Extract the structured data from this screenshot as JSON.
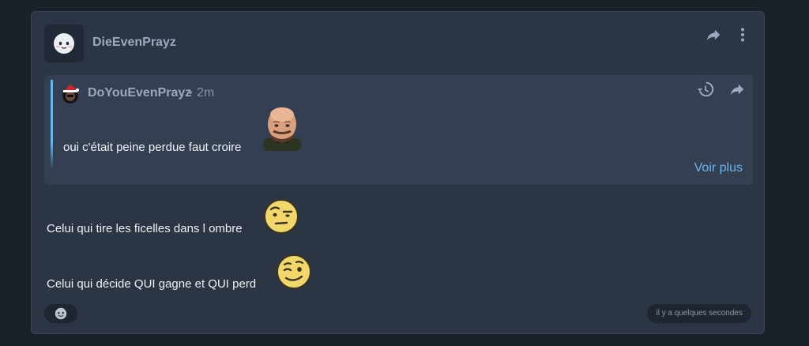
{
  "post": {
    "author": "DieEvenPrayz",
    "avatar_icon": "ghost-face-icon",
    "actions": {
      "share_icon": "share-arrow-icon",
      "menu_icon": "vertical-dots-icon"
    }
  },
  "quote": {
    "author": "DoYouEvenPrayz",
    "separator": "•",
    "time": "2m",
    "text": "oui c'était peine perdue faut croire",
    "emoji_icon": "bald-man-face-icon",
    "history_icon": "history-icon",
    "share_icon": "share-arrow-icon",
    "see_more": "Voir plus",
    "accent": "#67b5ef"
  },
  "messages": [
    {
      "text": "Celui qui tire les ficelles dans l ombre",
      "emoji_icon": "raised-eyebrow-emoji-icon"
    },
    {
      "text": "Celui qui décide QUI gagne et QUI perd",
      "emoji_icon": "winking-emoji-icon"
    }
  ],
  "footer": {
    "reaction_icon": "add-reaction-icon",
    "timestamp": "il y a quelques secondes"
  }
}
